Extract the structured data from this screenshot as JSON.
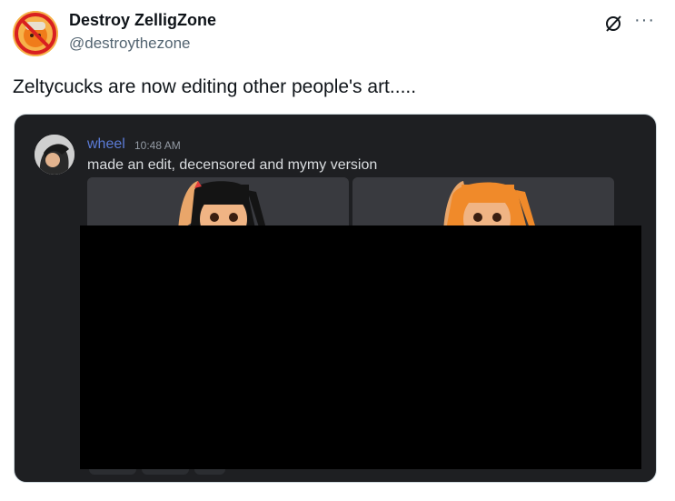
{
  "tweet": {
    "display_name": "Destroy ZelligZone",
    "handle": "@destroythezone",
    "text": "Zeltycucks are now editing other people's art.....",
    "icons": {
      "avatar": "no-symbol-character-avatar",
      "grok": "grok-icon",
      "more": "more-icon"
    },
    "more_glyph": "···"
  },
  "discord_screenshot": {
    "username": "wheel",
    "timestamp": "10:48 AM",
    "message": "made an edit, decensored and mymy version",
    "colors": {
      "background": "#1e1f22",
      "username": "#5b7bd6",
      "censor": "#000000"
    }
  }
}
